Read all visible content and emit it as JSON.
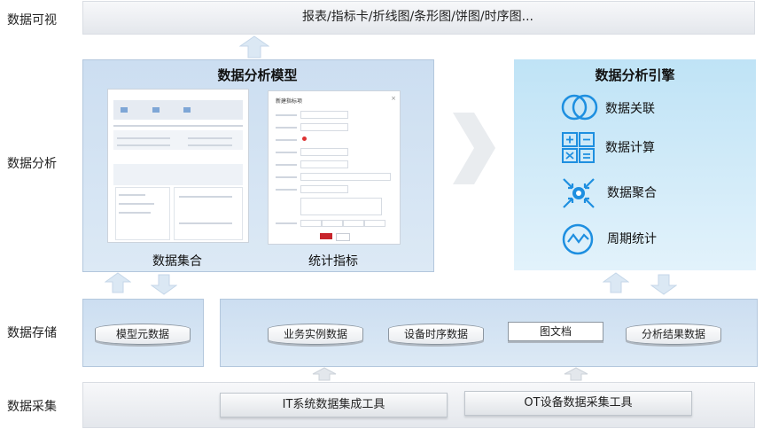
{
  "layers": {
    "visualization": "数据可视",
    "analysis": "数据分析",
    "storage": "数据存储",
    "collection": "数据采集"
  },
  "visualization": {
    "text": "报表/指标卡/折线图/条形图/饼图/时序图..."
  },
  "model": {
    "title": "数据分析模型",
    "left_caption": "数据集合",
    "right_caption": "统计指标",
    "form_title": "新建指标项"
  },
  "engine": {
    "title": "数据分析引擎",
    "items": [
      {
        "label": "数据关联",
        "icon": "venn-icon"
      },
      {
        "label": "数据计算",
        "icon": "calculator-icon"
      },
      {
        "label": "数据聚合",
        "icon": "aggregate-icon"
      },
      {
        "label": "周期统计",
        "icon": "wave-icon"
      }
    ]
  },
  "storage": {
    "meta": "模型元数据",
    "items": [
      "业务实例数据",
      "设备时序数据",
      "图文档",
      "分析结果数据"
    ]
  },
  "collection": {
    "tools": [
      "IT系统数据集成工具",
      "OT设备数据采集工具"
    ]
  },
  "colors": {
    "accent": "#1e8fe0",
    "grey_panel": "#e8ebef",
    "blue_panel": "#d3e3f3",
    "engine_panel": "#cbe8f8"
  }
}
